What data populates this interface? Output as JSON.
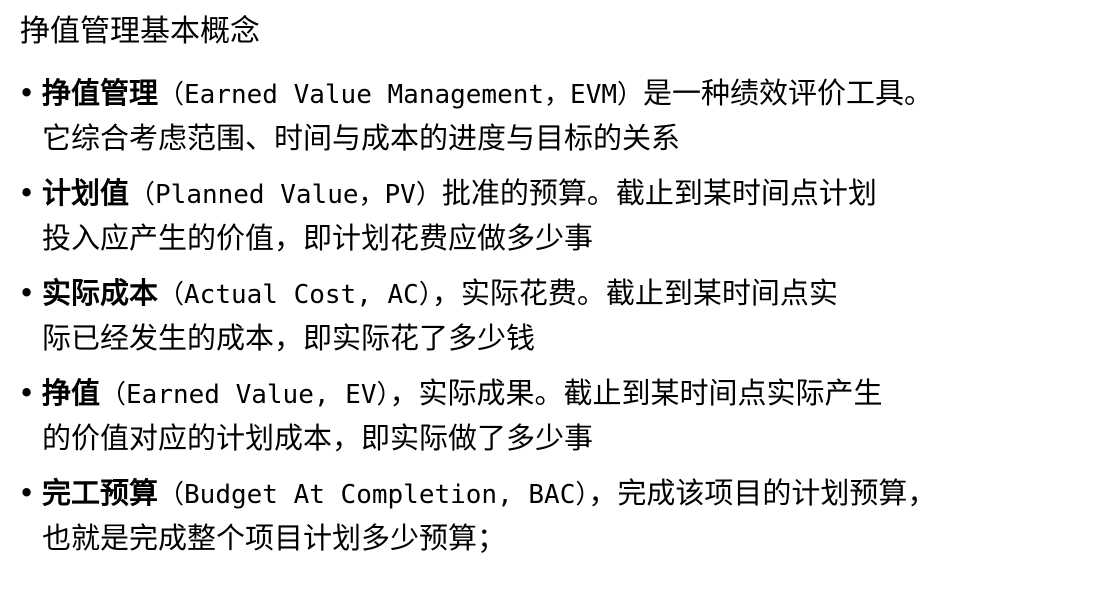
{
  "title": "挣值管理基本概念",
  "items": [
    {
      "term": "挣值管理",
      "abbr": "（Earned Value Management，EVM）",
      "rest1": "是一种绩效评价工具。",
      "line2": "它综合考虑范围、时间与成本的进度与目标的关系"
    },
    {
      "term": "计划值",
      "abbr": "（Planned Value，PV）",
      "rest1": "批准的预算。截止到某时间点计划",
      "line2": "投入应产生的价值，即计划花费应做多少事"
    },
    {
      "term": "实际成本",
      "abbr": "（Actual Cost, AC）",
      "rest1": "，实际花费。截止到某时间点实",
      "line2": "际已经发生的成本，即实际花了多少钱"
    },
    {
      "term": "挣值",
      "abbr": "（Earned Value, EV）",
      "rest1": "，实际成果。截止到某时间点实际产生",
      "line2": "的价值对应的计划成本，即实际做了多少事"
    },
    {
      "term": "完工预算",
      "abbr": "（Budget At Completion, BAC）",
      "rest1": "，完成该项目的计划预算，",
      "line2": "也就是完成整个项目计划多少预算；"
    }
  ]
}
